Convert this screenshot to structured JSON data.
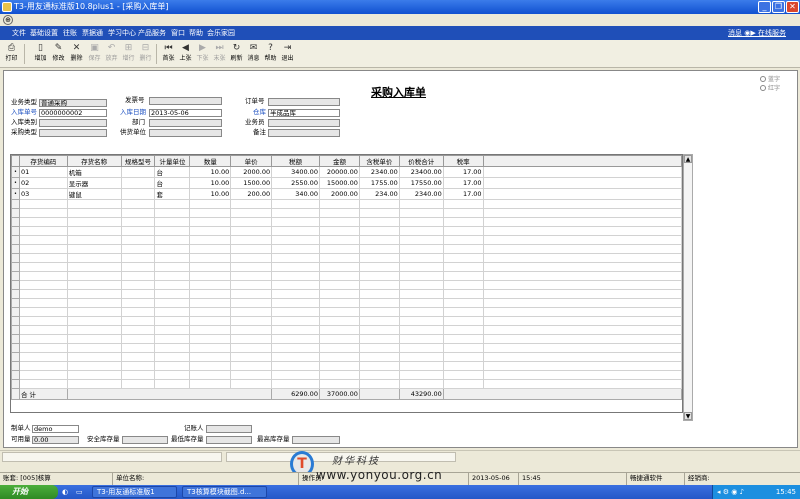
{
  "window": {
    "title": "T3-用友通标准版10.8plus1 - [采购入库单]"
  },
  "menu": {
    "items": [
      "文件",
      "基础设置",
      "往账",
      "票据通",
      "学习中心",
      "产品服务",
      "窗口",
      "帮助",
      "会乐家园"
    ],
    "right": "消息  ◉▶ 在线服务"
  },
  "toolbar": {
    "print": "打印",
    "add": "增加",
    "edit": "修改",
    "delete": "删除",
    "save": "保存",
    "abandon": "放弃",
    "add_row": "增行",
    "delete_row": "删行",
    "first": "首张",
    "prev": "上张",
    "next": "下张",
    "last": "末张",
    "refresh": "刷新",
    "ops": "消息",
    "help": "帮助",
    "exit": "退出"
  },
  "form": {
    "title": "采购入库单",
    "radio_blue": "蓝字",
    "radio_red": "红字",
    "business_type_label": "业务类型",
    "business_type_value": "普通采购",
    "invoice_label": "发票号",
    "invoice_value": "",
    "order_label": "订单号",
    "order_value": "",
    "receipt_no_label": "入库单号",
    "receipt_no_value": "0000000002",
    "date_label": "入库日期",
    "date_value": "2013-05-06",
    "warehouse_label": "仓库",
    "warehouse_value": "半成品库",
    "category_label": "入库类别",
    "category_value": "",
    "dept_label": "部门",
    "dept_value": "",
    "clerk_label": "业务员",
    "clerk_value": "",
    "purchase_type_label": "采购类型",
    "purchase_type_value": "",
    "supplier_label": "供货单位",
    "supplier_value": "",
    "note_label": "备注",
    "note_value": ""
  },
  "grid": {
    "headers": [
      "存货编码",
      "存货名称",
      "规格型号",
      "计量单位",
      "数量",
      "单价",
      "税额",
      "金额",
      "含税单价",
      "价税合计",
      "税率"
    ],
    "rows": [
      [
        "01",
        "机箱",
        "",
        "台",
        "10.00",
        "2000.00",
        "3400.00",
        "20000.00",
        "2340.00",
        "23400.00",
        "17.00"
      ],
      [
        "02",
        "显示器",
        "",
        "台",
        "10.00",
        "1500.00",
        "2550.00",
        "15000.00",
        "1755.00",
        "17550.00",
        "17.00"
      ],
      [
        "03",
        "键鼠",
        "",
        "套",
        "10.00",
        "200.00",
        "340.00",
        "2000.00",
        "234.00",
        "2340.00",
        "17.00"
      ]
    ],
    "total_label": "合  计",
    "totals": {
      "tax": "6290.00",
      "amount": "37000.00",
      "tax_total": "43290.00"
    }
  },
  "footer": {
    "maker_label": "制单人",
    "maker_value": "demo",
    "bookkeeper_label": "记账人",
    "bookkeeper_value": "",
    "available_label": "可用量",
    "available_value": "0.00",
    "safety_label": "安全库存量",
    "safety_value": "",
    "min_label": "最低库存量",
    "min_value": "",
    "max_label": "最高库存量",
    "max_value": ""
  },
  "statusbar": {
    "account": "账套: [005]核算",
    "unit": "单位名称:",
    "operator": "操作员: ",
    "date": "2013-05-06",
    "time": "15:45",
    "vendor": "畅捷通软件",
    "dealer": "经销商:"
  },
  "watermark": {
    "brand": "财华科技",
    "url": "www.yonyou.org.cn",
    "logo": "T"
  },
  "taskbar": {
    "start": "开始",
    "task1": "T3-用友通标准版1",
    "task2": "T3核算模块截图.d...",
    "clock": "15:45"
  }
}
